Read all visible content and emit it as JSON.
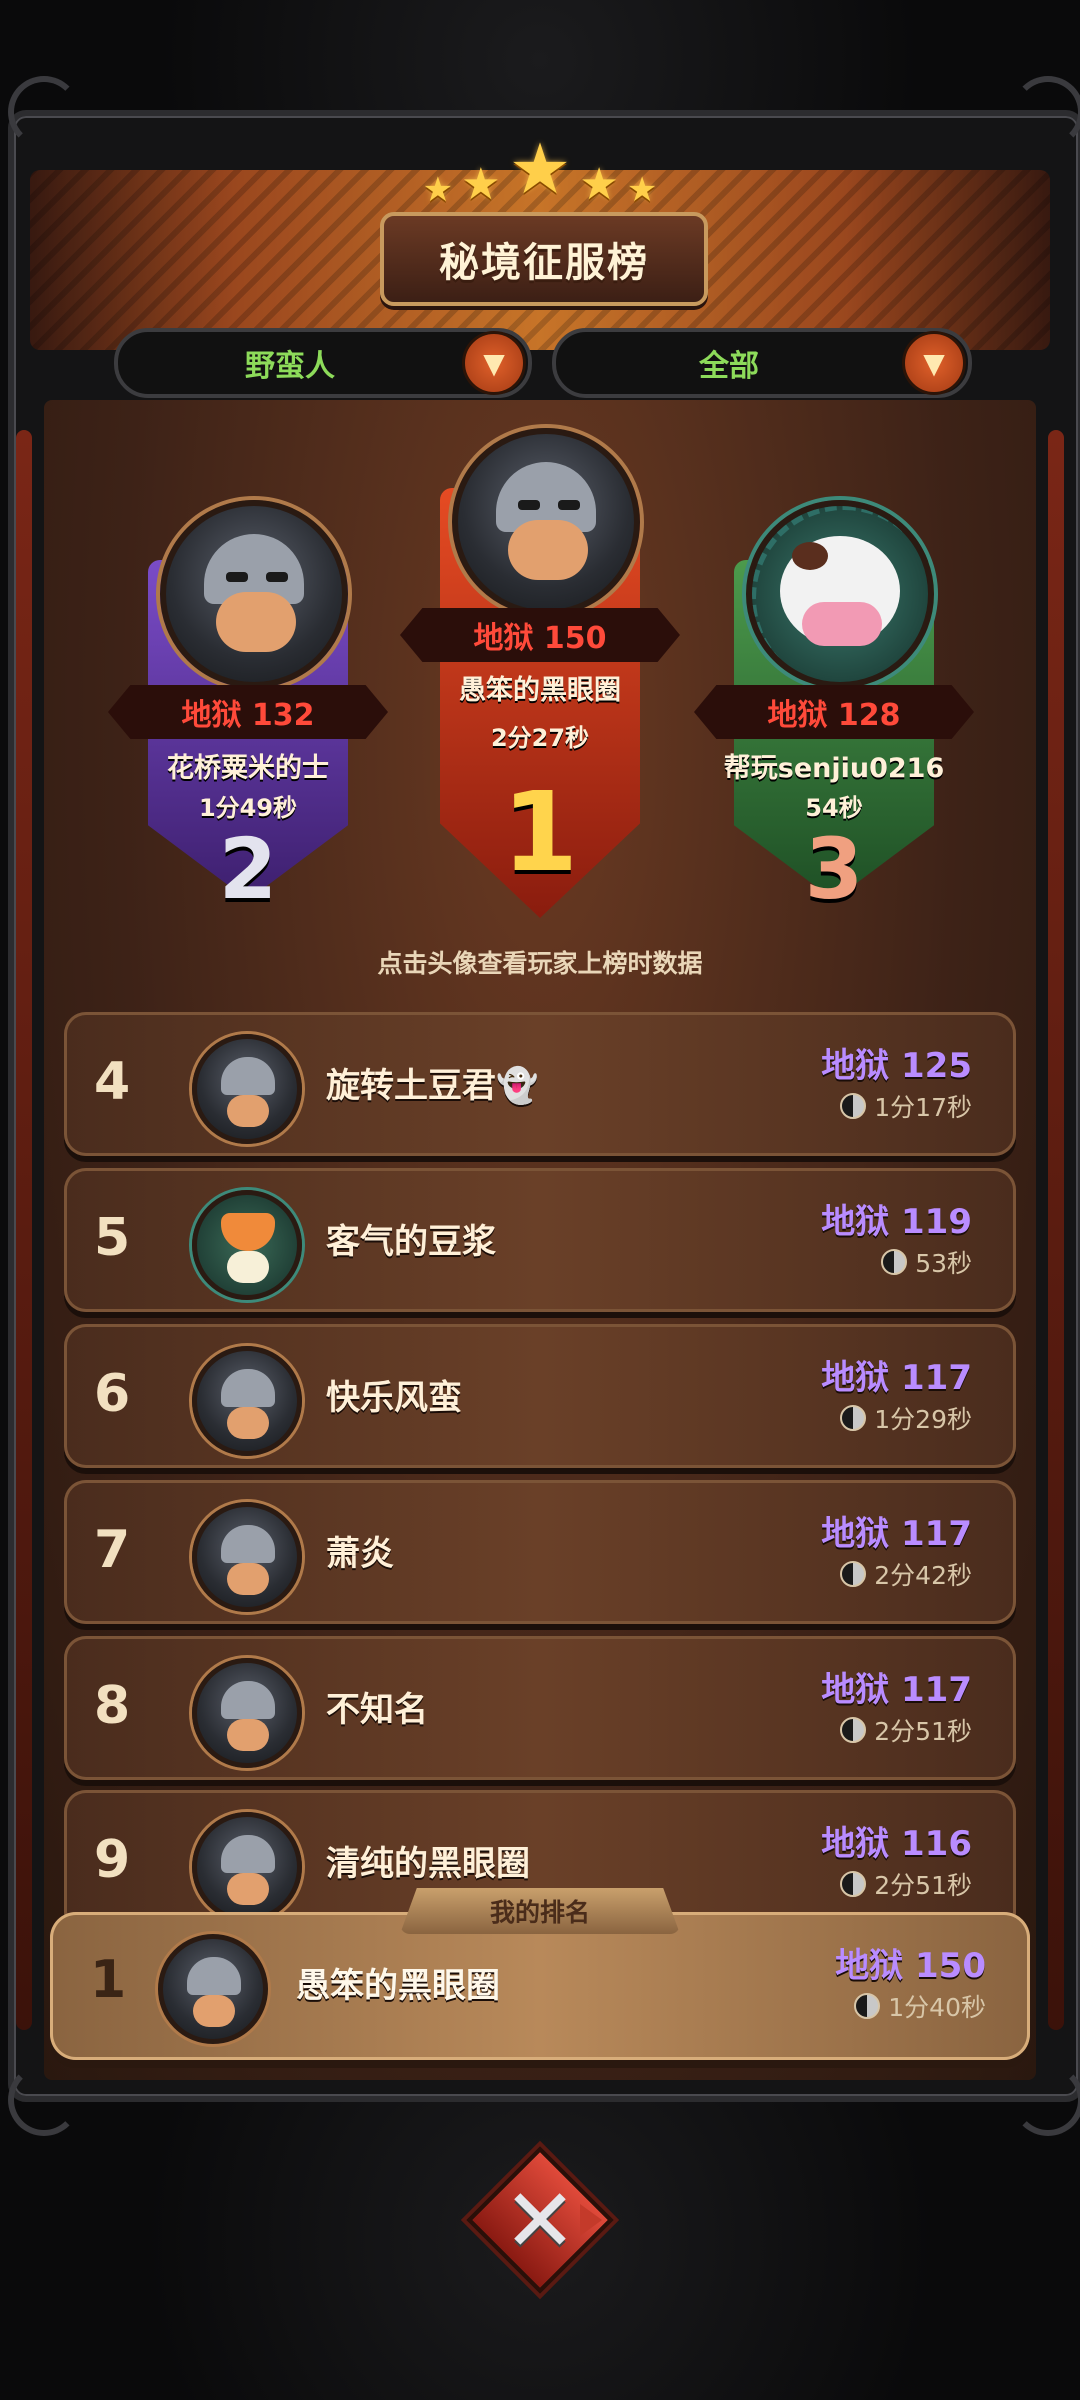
{
  "header": {
    "title": "秘境征服榜",
    "stars": 5
  },
  "filters": {
    "class": "野蛮人",
    "scope": "全部"
  },
  "podium": [
    {
      "rank": "2",
      "score": "地狱 132",
      "name": "花桥粟米的士",
      "time": "1分49秒",
      "avatar": "helmet"
    },
    {
      "rank": "1",
      "score": "地狱 150",
      "name": "愚笨的黑眼圈",
      "time": "2分27秒",
      "avatar": "helmet"
    },
    {
      "rank": "3",
      "score": "地狱 128",
      "name": "帮玩senjiu0216",
      "time": "54秒",
      "avatar": "cow"
    }
  ],
  "hint": "点击头像查看玩家上榜时数据",
  "list": [
    {
      "rank": "4",
      "name": "旋转土豆君👻",
      "score": "地狱 125",
      "time": "1分17秒",
      "avatar": "helmet"
    },
    {
      "rank": "5",
      "name": "客气的豆浆",
      "score": "地狱 119",
      "time": "53秒",
      "avatar": "fox"
    },
    {
      "rank": "6",
      "name": "快乐风蛮",
      "score": "地狱 117",
      "time": "1分29秒",
      "avatar": "helmet"
    },
    {
      "rank": "7",
      "name": "萧炎",
      "score": "地狱 117",
      "time": "2分42秒",
      "avatar": "helmet"
    },
    {
      "rank": "8",
      "name": "不知名",
      "score": "地狱 117",
      "time": "2分51秒",
      "avatar": "helmet"
    },
    {
      "rank": "9",
      "name": "清纯的黑眼圈",
      "score": "地狱 116",
      "time": "2分51秒",
      "avatar": "helmet"
    }
  ],
  "my_rank": {
    "tag": "我的排名",
    "rank": "1",
    "name": "愚笨的黑眼圈",
    "score": "地狱 150",
    "time": "1分40秒"
  },
  "colors": {
    "accent_gold": "#ffd44c",
    "score_purple": "#b98cff",
    "score_red": "#ff4a3a",
    "filter_green": "#8ddb5a"
  },
  "icons": {
    "dropdown": "chevron-down-icon",
    "clock": "clock-icon",
    "close": "close-icon"
  }
}
